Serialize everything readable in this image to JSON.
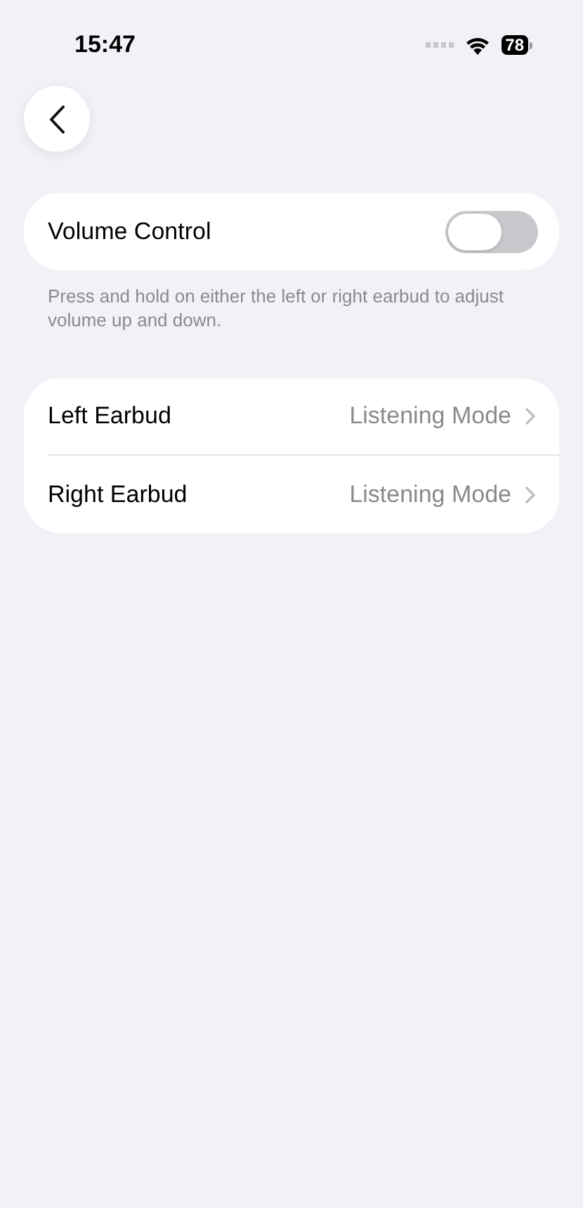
{
  "status_bar": {
    "time": "15:47",
    "battery": "78"
  },
  "volume_control": {
    "label": "Volume Control",
    "on": false,
    "footer": "Press and hold on either the left or right earbud to adjust volume up and down."
  },
  "earbuds": [
    {
      "label": "Left Earbud",
      "value": "Listening Mode"
    },
    {
      "label": "Right Earbud",
      "value": "Listening Mode"
    }
  ]
}
